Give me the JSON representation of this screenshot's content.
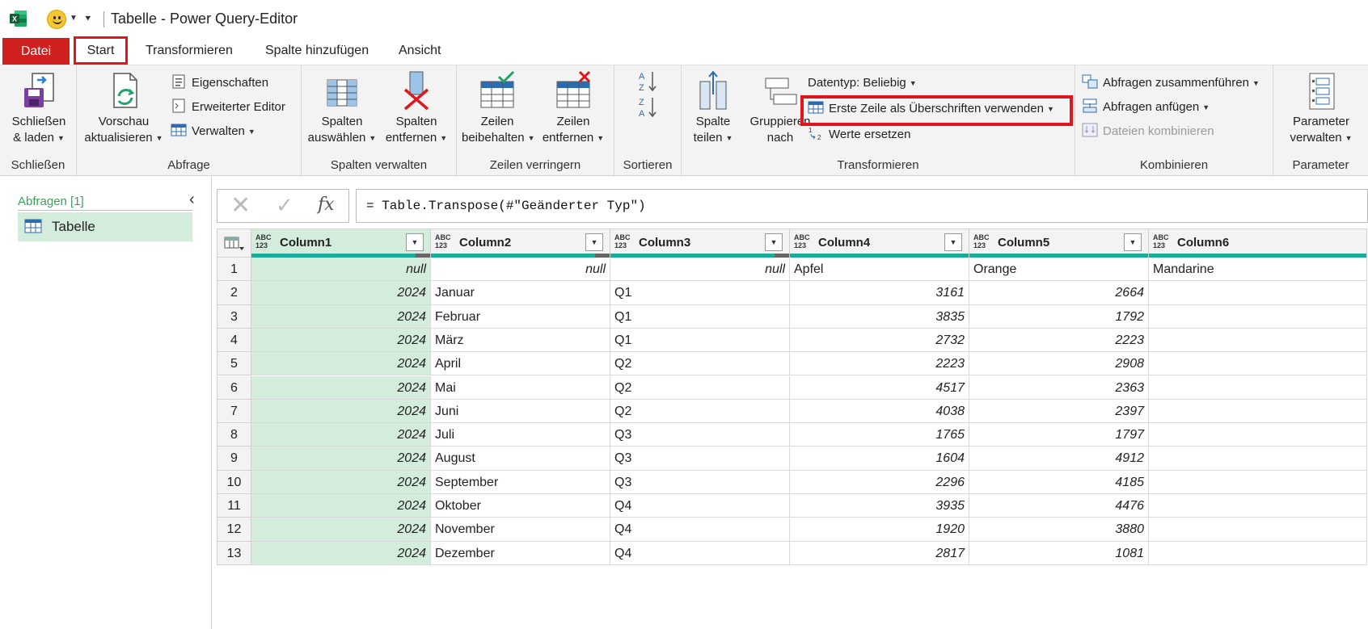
{
  "titlebar": {
    "title": "Tabelle - Power Query-Editor"
  },
  "tabs": [
    {
      "label": "Datei"
    },
    {
      "label": "Start"
    },
    {
      "label": "Transformieren"
    },
    {
      "label": "Spalte hinzufügen"
    },
    {
      "label": "Ansicht"
    }
  ],
  "ribbon": {
    "close": {
      "label1": "Schließen",
      "label2": "& laden",
      "group": "Schließen"
    },
    "query": {
      "preview1": "Vorschau",
      "preview2": "aktualisieren",
      "properties": "Eigenschaften",
      "advanced": "Erweiterter Editor",
      "manage": "Verwalten",
      "group": "Abfrage"
    },
    "columns": {
      "select1": "Spalten",
      "select2": "auswählen",
      "remove1": "Spalten",
      "remove2": "entfernen",
      "group": "Spalten verwalten"
    },
    "rows": {
      "keep1": "Zeilen",
      "keep2": "beibehalten",
      "remove1": "Zeilen",
      "remove2": "entfernen",
      "group": "Zeilen verringern"
    },
    "sort": {
      "group": "Sortieren"
    },
    "transform": {
      "split1": "Spalte",
      "split2": "teilen",
      "groupby1": "Gruppieren",
      "groupby2": "nach",
      "datatype": "Datentyp: Beliebig",
      "firstrow": "Erste Zeile als Überschriften verwenden",
      "replace": "Werte ersetzen",
      "group": "Transformieren"
    },
    "combine": {
      "merge": "Abfragen zusammenführen",
      "append": "Abfragen anfügen",
      "files": "Dateien kombinieren",
      "group": "Kombinieren"
    },
    "params": {
      "label1": "Parameter",
      "label2": "verwalten",
      "group": "Parameter"
    }
  },
  "queries": {
    "header": "Abfragen [1]",
    "items": [
      {
        "label": "Tabelle"
      }
    ]
  },
  "formula": {
    "text": "= Table.Transpose(#\"Geänderter Typ\")"
  },
  "grid": {
    "type_abc": "ABC",
    "type_123": "123",
    "columns": [
      "Column1",
      "Column2",
      "Column3",
      "Column4",
      "Column5",
      "Column6"
    ],
    "rows": [
      [
        "1",
        "null",
        "null",
        "null",
        "Apfel",
        "Orange",
        "Mandarine"
      ],
      [
        "2",
        "2024",
        "Januar",
        "Q1",
        "3161",
        "2664",
        ""
      ],
      [
        "3",
        "2024",
        "Februar",
        "Q1",
        "3835",
        "1792",
        ""
      ],
      [
        "4",
        "2024",
        "März",
        "Q1",
        "2732",
        "2223",
        ""
      ],
      [
        "5",
        "2024",
        "April",
        "Q2",
        "2223",
        "2908",
        ""
      ],
      [
        "6",
        "2024",
        "Mai",
        "Q2",
        "4517",
        "2363",
        ""
      ],
      [
        "7",
        "2024",
        "Juni",
        "Q2",
        "4038",
        "2397",
        ""
      ],
      [
        "8",
        "2024",
        "Juli",
        "Q3",
        "1765",
        "1797",
        ""
      ],
      [
        "9",
        "2024",
        "August",
        "Q3",
        "1604",
        "4912",
        ""
      ],
      [
        "10",
        "2024",
        "September",
        "Q3",
        "2296",
        "4185",
        ""
      ],
      [
        "11",
        "2024",
        "Oktober",
        "Q4",
        "3935",
        "4476",
        ""
      ],
      [
        "12",
        "2024",
        "November",
        "Q4",
        "1920",
        "3880",
        ""
      ],
      [
        "13",
        "2024",
        "Dezember",
        "Q4",
        "2817",
        "1081",
        ""
      ]
    ]
  },
  "colors": {
    "accent_red": "#d01f1f",
    "highlight_red": "#e0161d",
    "selection_green": "#d4ecdc",
    "quality_teal": "#1aab9b",
    "query_header_green": "#3f9f5a"
  }
}
